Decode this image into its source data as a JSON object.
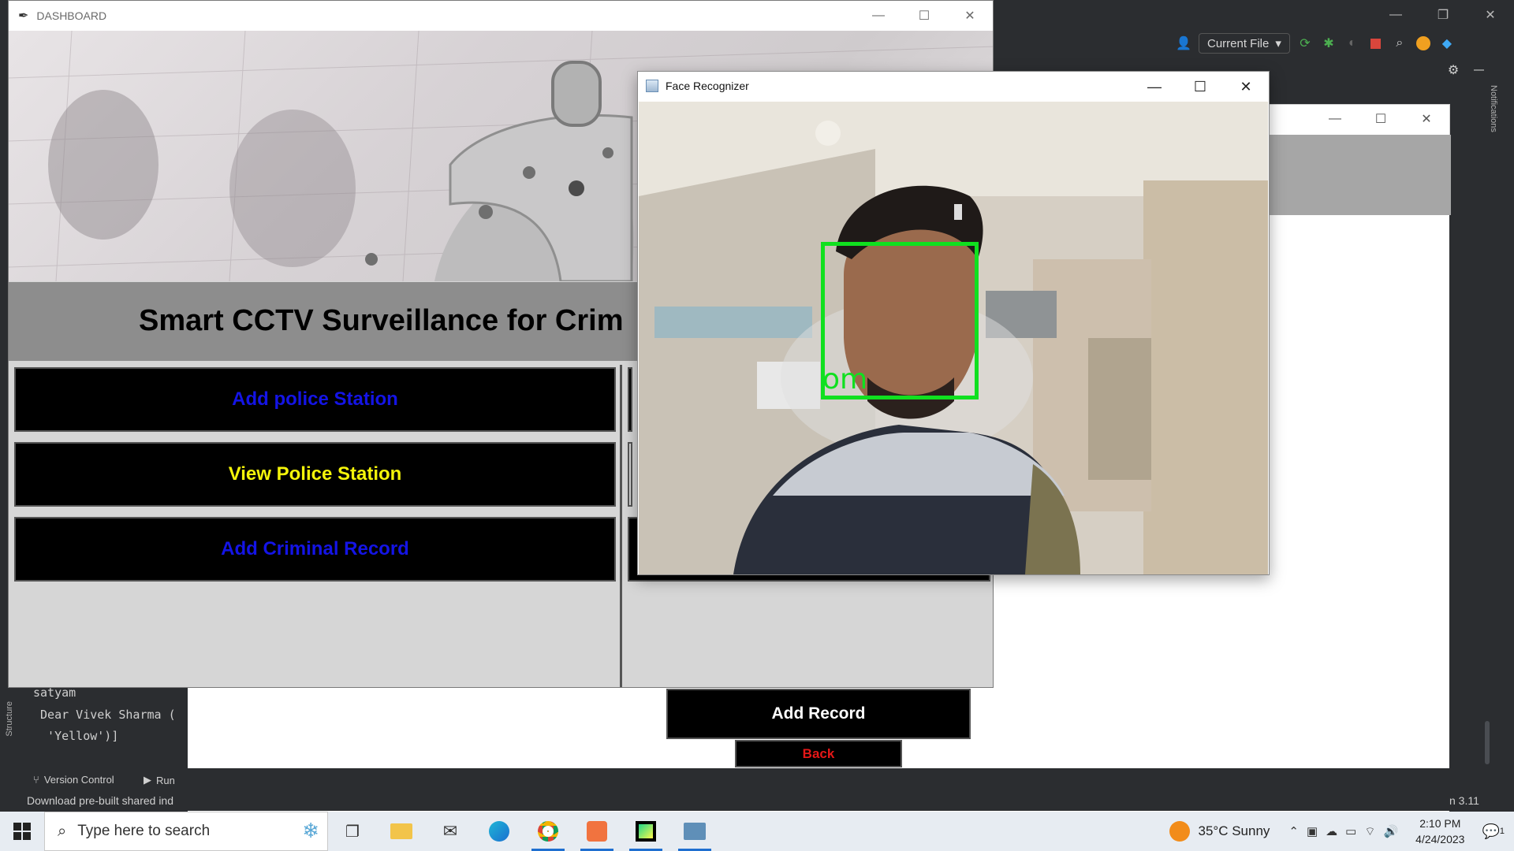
{
  "ide": {
    "window_controls": [
      "—",
      "❐",
      "✕"
    ],
    "run_config": "Current File",
    "notifications_label": "Notifications",
    "structure_label": "Structure",
    "console_lines": [
      "satyam",
      " Dear Vivek Sharma (",
      "  'Yellow')]"
    ],
    "bottom_tabs": [
      {
        "label": "Version Control",
        "icon": "branch-icon"
      },
      {
        "label": "Run",
        "icon": "run-icon"
      }
    ],
    "status_message": "Download pre-built shared ind",
    "python_version": "n 3.11"
  },
  "dashboard": {
    "title": "DASHBOARD",
    "app_title": "Smart CCTV Surveillance for Crim",
    "buttons": [
      {
        "label": "Add police Station",
        "color": "#1414e6"
      },
      {
        "label": "View Police Station",
        "color": "#f4f40a"
      },
      {
        "label": "Add Criminal Record",
        "color": "#1414e6"
      }
    ],
    "add_record_label": "Add Record",
    "back_label": "Back"
  },
  "face_window": {
    "title": "Face Recognizer",
    "detection_label": "om",
    "box_color": "#10e01f"
  },
  "taskbar": {
    "search_placeholder": "Type here to search",
    "weather": "35°C  Sunny",
    "time": "2:10 PM",
    "date": "4/24/2023",
    "notification_count": "1"
  }
}
